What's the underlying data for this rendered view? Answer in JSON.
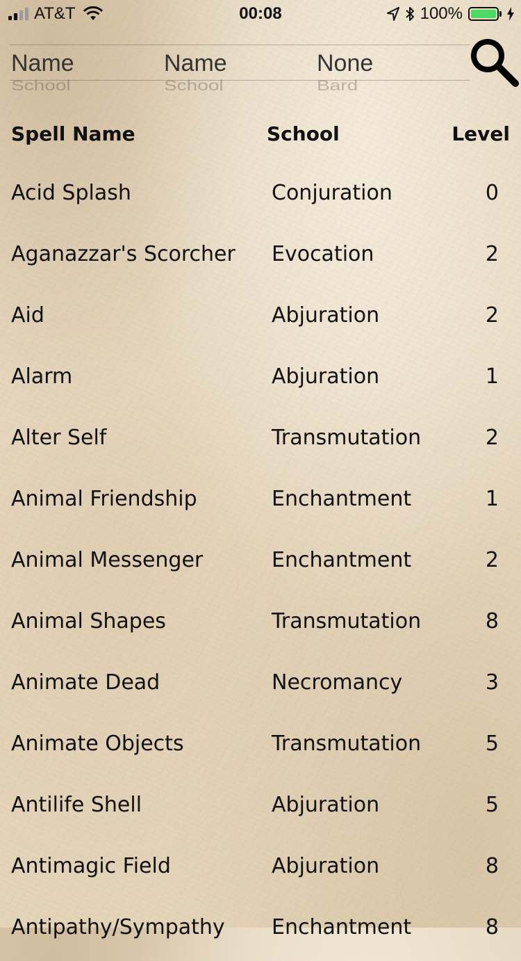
{
  "status_bar": {
    "carrier": "AT&T",
    "time": "00:08",
    "battery_percent": "100%",
    "battery_level": 1.0,
    "signal_bars": 4,
    "signal_bars_filled": 2
  },
  "filters": {
    "pickers": [
      {
        "selected": "Name",
        "next": "School"
      },
      {
        "selected": "Name",
        "next": "School"
      },
      {
        "selected": "None",
        "next": "Bard"
      }
    ]
  },
  "table": {
    "headers": {
      "name": "Spell Name",
      "school": "School",
      "level": "Level"
    },
    "rows": [
      {
        "name": "Acid Splash",
        "school": "Conjuration",
        "level": "0"
      },
      {
        "name": "Aganazzar's Scorcher",
        "school": "Evocation",
        "level": "2"
      },
      {
        "name": "Aid",
        "school": "Abjuration",
        "level": "2"
      },
      {
        "name": "Alarm",
        "school": "Abjuration",
        "level": "1"
      },
      {
        "name": "Alter Self",
        "school": "Transmutation",
        "level": "2"
      },
      {
        "name": "Animal Friendship",
        "school": "Enchantment",
        "level": "1"
      },
      {
        "name": "Animal Messenger",
        "school": "Enchantment",
        "level": "2"
      },
      {
        "name": "Animal Shapes",
        "school": "Transmutation",
        "level": "8"
      },
      {
        "name": "Animate Dead",
        "school": "Necromancy",
        "level": "3"
      },
      {
        "name": "Animate Objects",
        "school": "Transmutation",
        "level": "5"
      },
      {
        "name": "Antilife Shell",
        "school": "Abjuration",
        "level": "5"
      },
      {
        "name": "Antimagic Field",
        "school": "Abjuration",
        "level": "8"
      },
      {
        "name": "Antipathy/Sympathy",
        "school": "Enchantment",
        "level": "8"
      }
    ]
  },
  "icons": {
    "search": "search-icon",
    "wifi": "wifi-icon",
    "location": "location-arrow-icon",
    "bluetooth": "bluetooth-icon",
    "charging": "charging-bolt-icon"
  },
  "colors": {
    "battery_fill": "#4cd964",
    "parchment": "#e6d7bf"
  }
}
